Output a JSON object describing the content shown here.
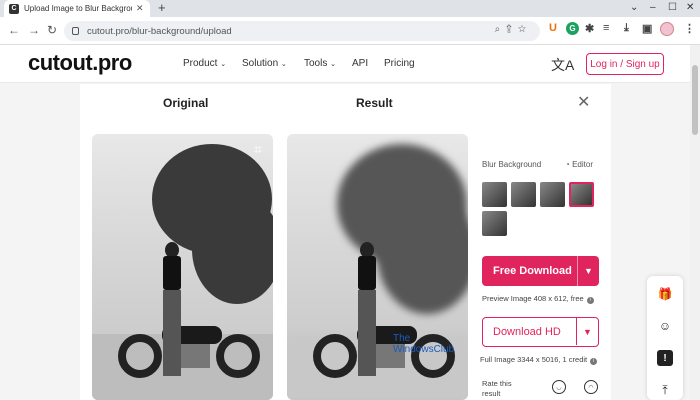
{
  "browser": {
    "tab_title": "Upload Image to Blur Background",
    "tab_favicon": "C",
    "new_tab": "+",
    "url": "cutout.pro/blur-background/upload",
    "ext_u": "U",
    "ext_g": "G"
  },
  "site": {
    "logo": "cutout.pro",
    "nav": [
      "Product",
      "Solution",
      "Tools",
      "API",
      "Pricing"
    ],
    "login": "Log in / Sign up"
  },
  "panel": {
    "original_title": "Original",
    "result_title": "Result",
    "watermark_line1": "The",
    "watermark_line2": "WindowsClub",
    "blur_label": "Blur Background",
    "editor_label": "Editor",
    "free_download": "Free Download",
    "preview_info": "Preview Image 408 x 612, free",
    "download_hd": "Download HD",
    "full_info": "Full Image 3344 x 5016, 1 credit",
    "rate": "Rate this result"
  },
  "colors": {
    "accent": "#e0245e"
  },
  "icons": [
    "crop-icon",
    "close-icon",
    "translate-icon",
    "gift-icon",
    "support-icon",
    "feedback-icon",
    "scroll-top-icon"
  ]
}
